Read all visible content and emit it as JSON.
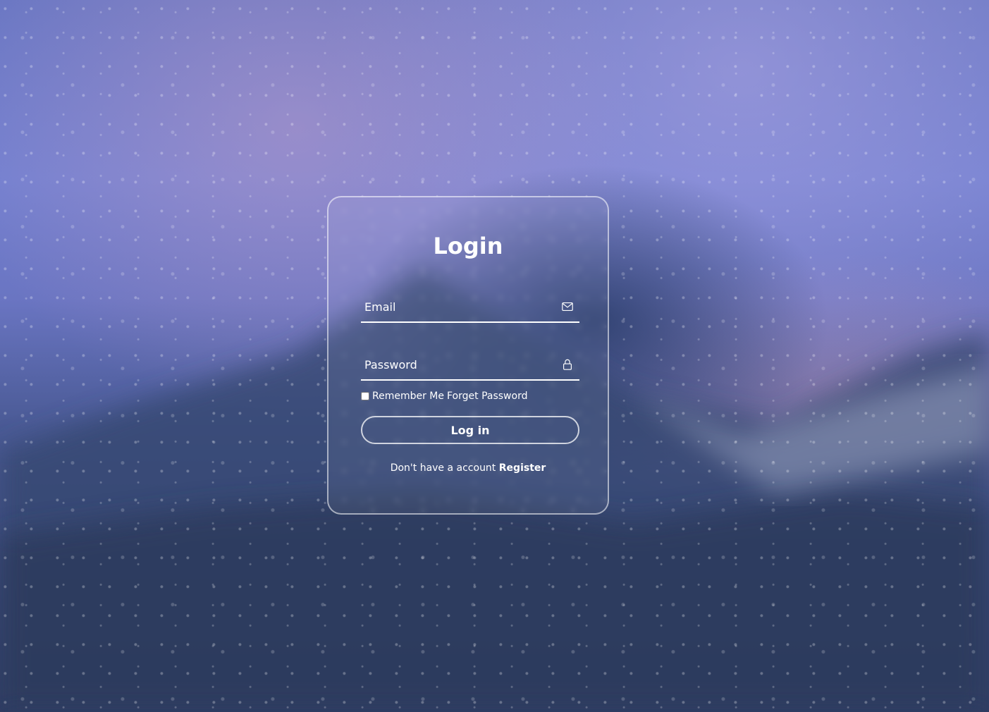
{
  "login": {
    "title": "Login",
    "email": {
      "placeholder": "Email",
      "icon": "mail-icon"
    },
    "password": {
      "placeholder": "Password",
      "icon": "lock-icon"
    },
    "remember_label": "Remember Me",
    "forgot_label": "Forget Password",
    "submit_label": "Log in",
    "register_prompt": "Don't have a account",
    "register_link": "Register"
  },
  "colors": {
    "text": "#ffffff",
    "background": "#6a77c3"
  }
}
